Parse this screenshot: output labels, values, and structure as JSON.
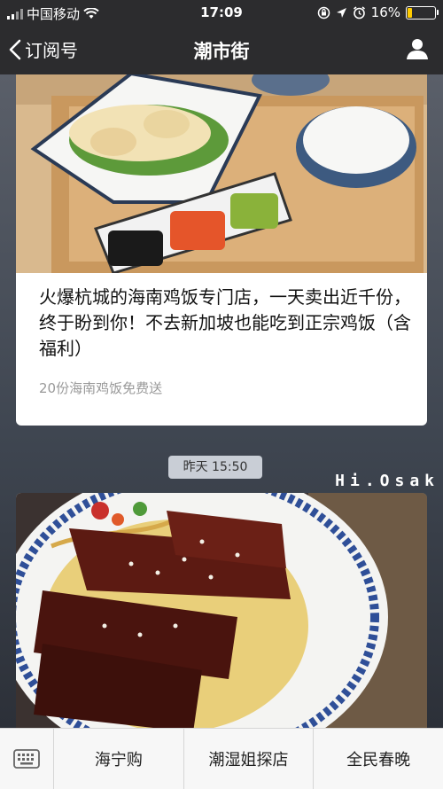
{
  "status_bar": {
    "carrier": "中国移动",
    "time": "17:09",
    "battery": "16%"
  },
  "nav": {
    "back_label": "订阅号",
    "title": "潮市街"
  },
  "articles": [
    {
      "title": "火爆杭城的海南鸡饭专门店，一天卖出近千份，终于盼到你！不去新加坡也能吃到正宗鸡饭（含福利）",
      "subtitle": "20份海南鸡饭免费送",
      "image": "hainan-chicken-rice-photo"
    },
    {
      "image": "char-siu-noodles-photo",
      "watermark": "Hi.Osak"
    }
  ],
  "timestamp": "昨天 15:50",
  "menu": {
    "items": [
      "海宁购",
      "潮湿姐探店",
      "全民春晚"
    ]
  },
  "colors": {
    "nav_bg": "#2c2c2e",
    "battery_low": "#ffcc00",
    "timestamp_bg": "#c9ced6"
  }
}
